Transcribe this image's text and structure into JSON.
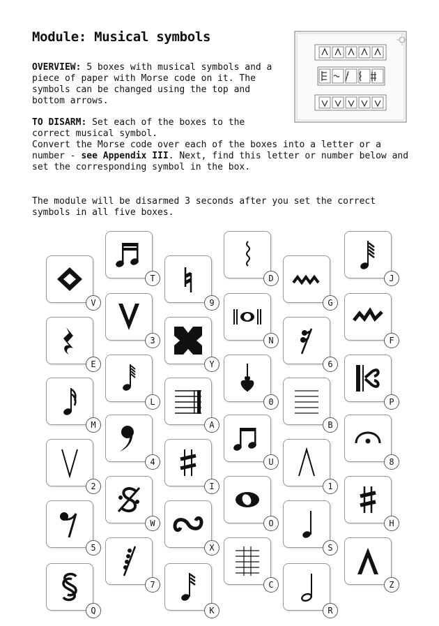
{
  "title": "Module: Musical symbols",
  "overview": {
    "label": "OVERVIEW:",
    "text": " 5 boxes with musical symbols and a piece of paper with Morse code on it. The symbols can be changed using the top and bottom arrows."
  },
  "disarm": {
    "label": "TO DISARM:",
    "text": " Set each of the boxes to the correct musical symbol.",
    "convert_text": "Convert the Morse code over each of the boxes into a letter or a number - ",
    "appendix": "see Appendix III",
    "convert_text_2": ". Next, find this letter or number below and set the corresponding symbol in the box."
  },
  "note": "The module will be disarmed 3 seconds after you set the correct symbols in all five boxes.",
  "symbols": [
    {
      "label": "V",
      "kind": "diamond"
    },
    {
      "label": "T",
      "kind": "beamed-notes"
    },
    {
      "label": "9",
      "kind": "natural"
    },
    {
      "label": "D",
      "kind": "squiggle-vertical"
    },
    {
      "label": "G",
      "kind": "mordent"
    },
    {
      "label": "J",
      "kind": "note-multi-flag"
    },
    {
      "label": "E",
      "kind": "quarter-rest"
    },
    {
      "label": "3",
      "kind": "v-accent-large"
    },
    {
      "label": "Y",
      "kind": "block-x"
    },
    {
      "label": "N",
      "kind": "breve-double"
    },
    {
      "label": "6",
      "kind": "sixteenth-rest"
    },
    {
      "label": "F",
      "kind": "mordent-big"
    },
    {
      "label": "M",
      "kind": "sixteenth-note"
    },
    {
      "label": "L",
      "kind": "note-stem-flags"
    },
    {
      "label": "A",
      "kind": "staff-barline"
    },
    {
      "label": "0",
      "kind": "segno-flat"
    },
    {
      "label": "B",
      "kind": "staff-short"
    },
    {
      "label": "P",
      "kind": "alto-clef"
    },
    {
      "label": "2",
      "kind": "v-thin"
    },
    {
      "label": "4",
      "kind": "bass-comma"
    },
    {
      "label": "I",
      "kind": "sharp"
    },
    {
      "label": "U",
      "kind": "eighth-pair"
    },
    {
      "label": "1",
      "kind": "caret-thin"
    },
    {
      "label": "8",
      "kind": "fermata"
    },
    {
      "label": "5",
      "kind": "eighth-rest"
    },
    {
      "label": "W",
      "kind": "segno-percent"
    },
    {
      "label": "X",
      "kind": "turn"
    },
    {
      "label": "O",
      "kind": "whole-note"
    },
    {
      "label": "S",
      "kind": "quarter-note"
    },
    {
      "label": "H",
      "kind": "sharp-bold"
    },
    {
      "label": "7",
      "kind": "sixtyfourth-rest"
    },
    {
      "label": "C",
      "kind": "staff-ledger"
    },
    {
      "label": "Z",
      "kind": "caret-bold"
    },
    {
      "label": "Q",
      "kind": "section-sign"
    },
    {
      "label": "K",
      "kind": "thirtysecond-note"
    },
    {
      "label": "R",
      "kind": "half-note"
    }
  ]
}
